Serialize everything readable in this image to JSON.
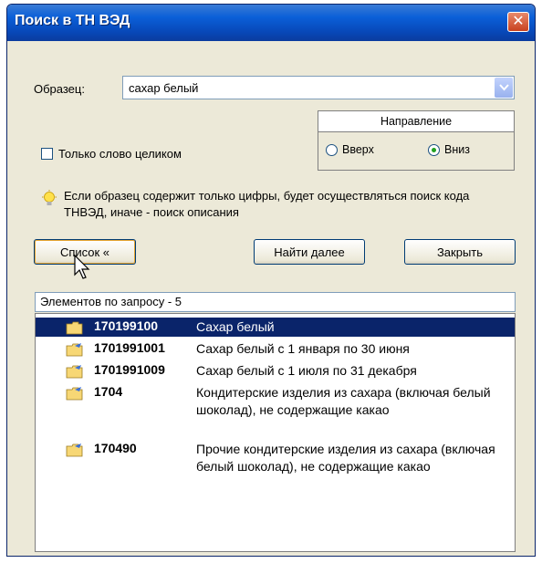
{
  "window": {
    "title": "Поиск в ТН ВЭД",
    "close_label": "✕"
  },
  "search": {
    "label": "Образец:",
    "value": "сахар белый"
  },
  "direction": {
    "header": "Направление",
    "up_label": "Вверх",
    "down_label": "Вниз",
    "selected": "down"
  },
  "whole_word": {
    "label": "Только слово целиком",
    "checked": false
  },
  "hint": {
    "text": "Если образец содержит только цифры, будет осуществляться поиск кода ТНВЭД, иначе - поиск описания",
    "icon": "lightbulb-icon"
  },
  "buttons": {
    "list": "Список «",
    "find_next": "Найти далее",
    "close": "Закрыть"
  },
  "results": {
    "count_text": "Элементов по запросу - 5",
    "items": [
      {
        "code": "170199100",
        "desc": "Сахар белый",
        "selected": true
      },
      {
        "code": "1701991001",
        "desc": "Сахар белый с 1 января по 30 июня",
        "selected": false
      },
      {
        "code": "1701991009",
        "desc": "Сахар белый с 1 июля по 31 декабря",
        "selected": false
      },
      {
        "code": "1704",
        "desc": "Кондитерские изделия из сахара (включая белый шоколад), не содержащие какао",
        "selected": false
      },
      {
        "code": "170490",
        "desc": "Прочие кондитерские изделия из сахара (включая белый шоколад), не содержащие какао",
        "selected": false
      }
    ]
  },
  "colors": {
    "titlebar": "#0a5fd8",
    "selection": "#0a246a",
    "window_bg": "#ece9d8"
  }
}
